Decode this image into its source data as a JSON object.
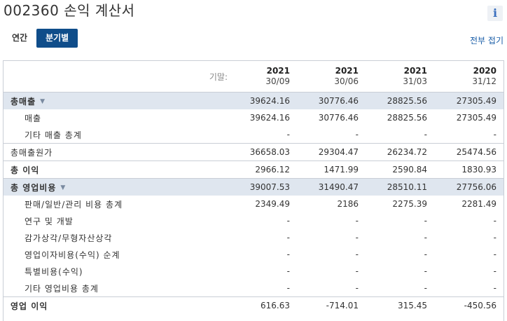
{
  "page": {
    "title": "002360 손익 계산서",
    "info_icon": "info-icon",
    "tabs": [
      {
        "label": "연간",
        "active": false
      },
      {
        "label": "분기별",
        "active": true
      }
    ],
    "collapse_all": "전부 접기"
  },
  "table": {
    "basis_label": "기말:",
    "periods": [
      {
        "year": "2021",
        "date": "30/09"
      },
      {
        "year": "2021",
        "date": "30/06"
      },
      {
        "year": "2021",
        "date": "31/03"
      },
      {
        "year": "2020",
        "date": "31/12"
      }
    ],
    "rows": [
      {
        "label": "총매출",
        "values": [
          "39624.16",
          "30776.46",
          "28825.56",
          "27305.49"
        ]
      },
      {
        "label": "매출",
        "values": [
          "39624.16",
          "30776.46",
          "28825.56",
          "27305.49"
        ]
      },
      {
        "label": "기타 매출 총계",
        "values": [
          "-",
          "-",
          "-",
          "-"
        ]
      },
      {
        "label": "총매출원가",
        "values": [
          "36658.03",
          "29304.47",
          "26234.72",
          "25474.56"
        ]
      },
      {
        "label": "총 이익",
        "values": [
          "2966.12",
          "1471.99",
          "2590.84",
          "1830.93"
        ]
      },
      {
        "label": "총 영업비용",
        "values": [
          "39007.53",
          "31490.47",
          "28510.11",
          "27756.06"
        ]
      },
      {
        "label": "판매/일반/관리 비용 총계",
        "values": [
          "2349.49",
          "2186",
          "2275.39",
          "2281.49"
        ]
      },
      {
        "label": "연구 및 개발",
        "values": [
          "-",
          "-",
          "-",
          "-"
        ]
      },
      {
        "label": "감가상각/무형자산상각",
        "values": [
          "-",
          "-",
          "-",
          "-"
        ]
      },
      {
        "label": "영업이자비용(수익) 순계",
        "values": [
          "-",
          "-",
          "-",
          "-"
        ]
      },
      {
        "label": "특별비용(수익)",
        "values": [
          "-",
          "-",
          "-",
          "-"
        ]
      },
      {
        "label": "기타 영업비용 총계",
        "values": [
          "-",
          "-",
          "-",
          "-"
        ]
      },
      {
        "label": "영업 이익",
        "values": [
          "616.63",
          "-714.01",
          "315.45",
          "-450.56"
        ]
      }
    ]
  },
  "colors": {
    "accent": "#0f4d8a",
    "highlight_row": "#dfe6ef",
    "link": "#1a5ea8"
  }
}
